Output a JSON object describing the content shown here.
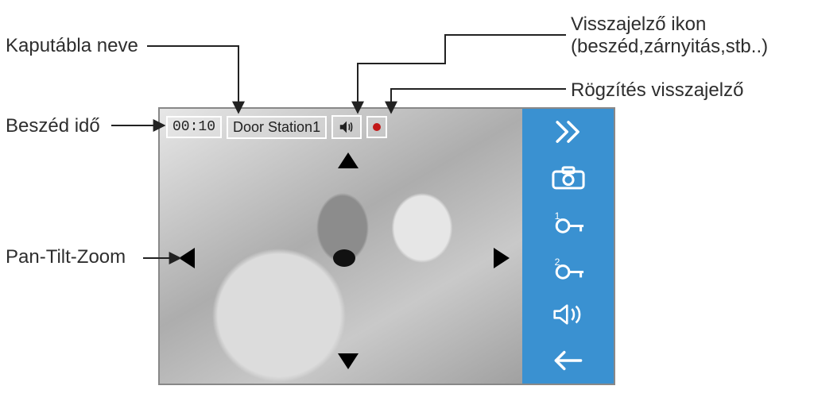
{
  "labels": {
    "door_name": "Kaputábla neve",
    "talk_time": "Beszéd idő",
    "ptz": "Pan-Tilt-Zoom",
    "feedback_icon_line1": "Visszajelző ikon",
    "feedback_icon_line2": "(beszéd,zárnyitás,stb..)",
    "record_indicator": "Rögzítés visszajelző"
  },
  "status": {
    "timer": "00:10",
    "door_station": "Door Station1"
  },
  "sidebar": {
    "next": "next",
    "snapshot": "snapshot",
    "unlock1_badge": "1",
    "unlock2_badge": "2",
    "volume": "volume",
    "back": "back"
  }
}
